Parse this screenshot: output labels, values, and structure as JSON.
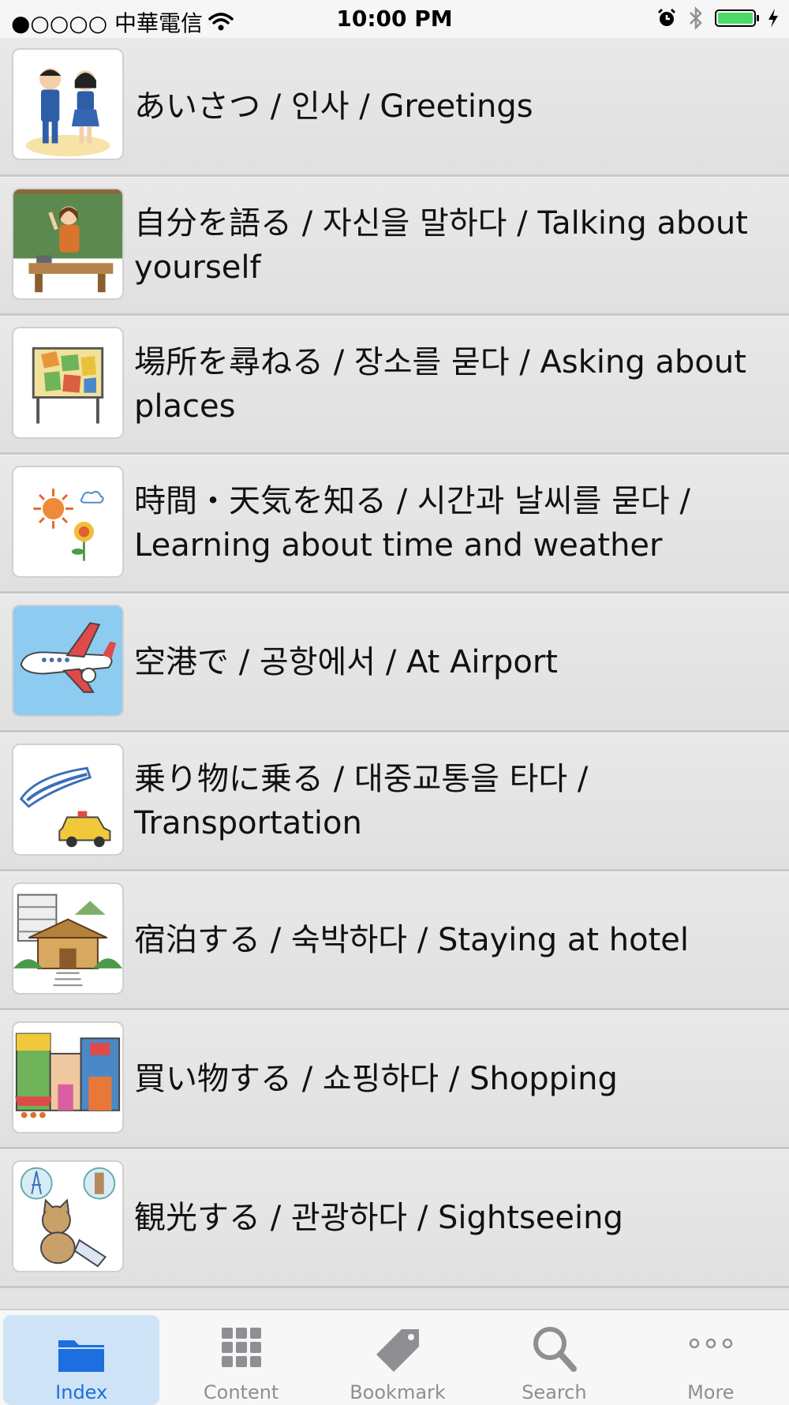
{
  "status_bar": {
    "carrier": "●○○○○ 中華電信",
    "time": "10:00 PM"
  },
  "list": {
    "items": [
      {
        "label": "あいさつ / 인사 / Greetings",
        "icon": "greetings-picture"
      },
      {
        "label": "自分を語る / 자신을 말하다 / Talking about yourself",
        "icon": "teacher-picture"
      },
      {
        "label": "場所を尋ねる / 장소를 묻다 / Asking about places",
        "icon": "map-board-picture"
      },
      {
        "label": "時間・天気を知る / 시간과 날씨를 묻다 / Learning about time and weather",
        "icon": "sun-flower-picture"
      },
      {
        "label": "空港で / 공항에서 / At Airport",
        "icon": "airplane-picture"
      },
      {
        "label": "乗り物に乗る / 대중교통을 타다 / Transportation",
        "icon": "train-taxi-picture"
      },
      {
        "label": "宿泊する / 숙박하다 / Staying at hotel",
        "icon": "hotel-picture"
      },
      {
        "label": "買い物する / 쇼핑하다 / Shopping",
        "icon": "shops-picture"
      },
      {
        "label": "観光する / 관광하다 / Sightseeing",
        "icon": "cat-travel-picture"
      }
    ]
  },
  "tabbar": {
    "tabs": [
      {
        "label": "Index",
        "icon": "folder-icon",
        "active": true
      },
      {
        "label": "Content",
        "icon": "grid-icon",
        "active": false
      },
      {
        "label": "Bookmark",
        "icon": "tag-icon",
        "active": false
      },
      {
        "label": "Search",
        "icon": "search-icon",
        "active": false
      },
      {
        "label": "More",
        "icon": "more-icon",
        "active": false
      }
    ]
  },
  "colors": {
    "accent": "#1b6fde",
    "active_tab_bg": "#cfe3f7",
    "battery": "#4cd964"
  }
}
